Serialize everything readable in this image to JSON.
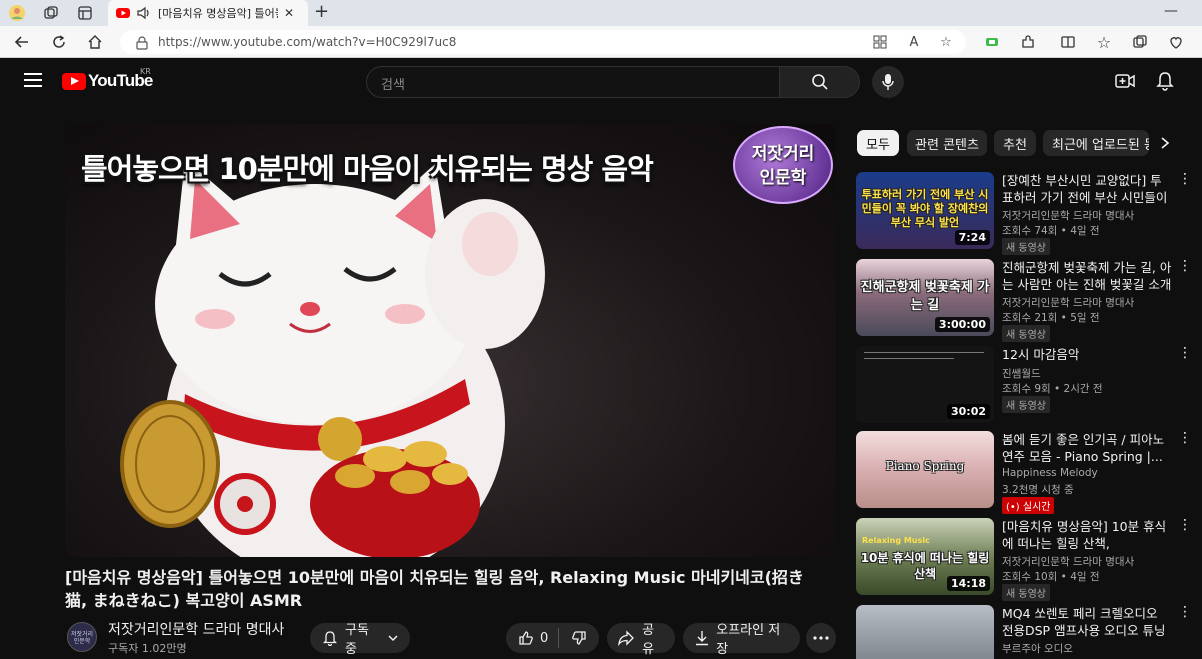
{
  "browser": {
    "tab_title": "[마음치유 명상음악] 틀어놓",
    "url": "https://www.youtube.com/watch?v=H0C929l7uc8"
  },
  "header": {
    "logo_text": "YouTube",
    "region": "KR",
    "search_placeholder": "검색"
  },
  "player": {
    "overlay_title": "틀어놓으면 10분만에 마음이 치유되는 명상 음악",
    "badge_line1": "저잣거리",
    "badge_line2": "인문학"
  },
  "video": {
    "title": "[마음치유 명상음악] 틀어놓으면 10분만에 마음이 치유되는 힐링 음악, Relaxing Music 마네키네코(招き猫, まねきねこ) 복고양이 ASMR",
    "channel_name": "저잣거리인문학 드라마 명대사",
    "subscribers": "구독자 1.02만명",
    "avatar_text": "저잣거리 인문학",
    "subscribed_label": "구독중",
    "like_count": "0",
    "share_label": "공유",
    "download_label": "오프라인 저장"
  },
  "chips": [
    "모두",
    "관련 콘텐츠",
    "추천",
    "최근에 업로드된 동영상"
  ],
  "recommendations": [
    {
      "title": "[장예찬 부산시민 교양없다] 투표하러 가기 전에 부산 시민들이 ...",
      "channel": "저잣거리인문학 드라마 명대사",
      "meta": "조회수 74회 • 4일 전",
      "badge": "새 동영상",
      "duration": "7:24",
      "thumb_caption": "투표하러 가기 전에 부산 시민들이 꼭 봐야 할 장예찬의 부산 무식 발언",
      "thumb_color": "#1e4fa8"
    },
    {
      "title": "진해군항제 벚꽃축제 가는 길, 아는 사람만 아는 진해 벚꽃길 소개",
      "channel": "저잣거리인문학 드라마 명대사",
      "meta": "조회수 21회 • 5일 전",
      "badge": "새 동영상",
      "duration": "3:00:00",
      "thumb_caption": "진해군항제 벚꽃축제 가는 길",
      "thumb_color": "#6e5a6a"
    },
    {
      "title": "12시 마감음악",
      "channel": "진쌤월드",
      "meta": "조회수 9회 • 2시간 전",
      "badge": "새 동영상",
      "duration": "30:02",
      "thumb_caption": "",
      "thumb_color": "#141414"
    },
    {
      "title": "봄에 듣기 좋은 인기곡 / 피아노 연주 모음 - Piano Spring |...",
      "channel": "Happiness Melody",
      "meta": "3.2천명 시청 중",
      "badge": "(•) 실시간",
      "duration": "",
      "thumb_caption": "Piano Spring",
      "thumb_color": "#d8b6b6"
    },
    {
      "title": "[마음치유 명상음악] 10분 휴식에 떠나는 힐링 산책, Relaxing...",
      "channel": "저잣거리인문학 드라마 명대사",
      "meta": "조회수 10회 • 4일 전",
      "badge": "새 동영상",
      "duration": "14:18",
      "thumb_caption": "10분 휴식에 떠나는 힐링 산책",
      "thumb_tag": "Relaxing Music",
      "thumb_color": "#5c6a4a"
    },
    {
      "title": "MQ4 쏘렌토 페리 크렐오디오 전용DSP 앰프사용 오디오 튜닝하...",
      "channel": "부르주아 오디오",
      "meta": "",
      "badge": "",
      "duration": "",
      "thumb_caption": "",
      "thumb_color": "#8a8f96"
    }
  ]
}
